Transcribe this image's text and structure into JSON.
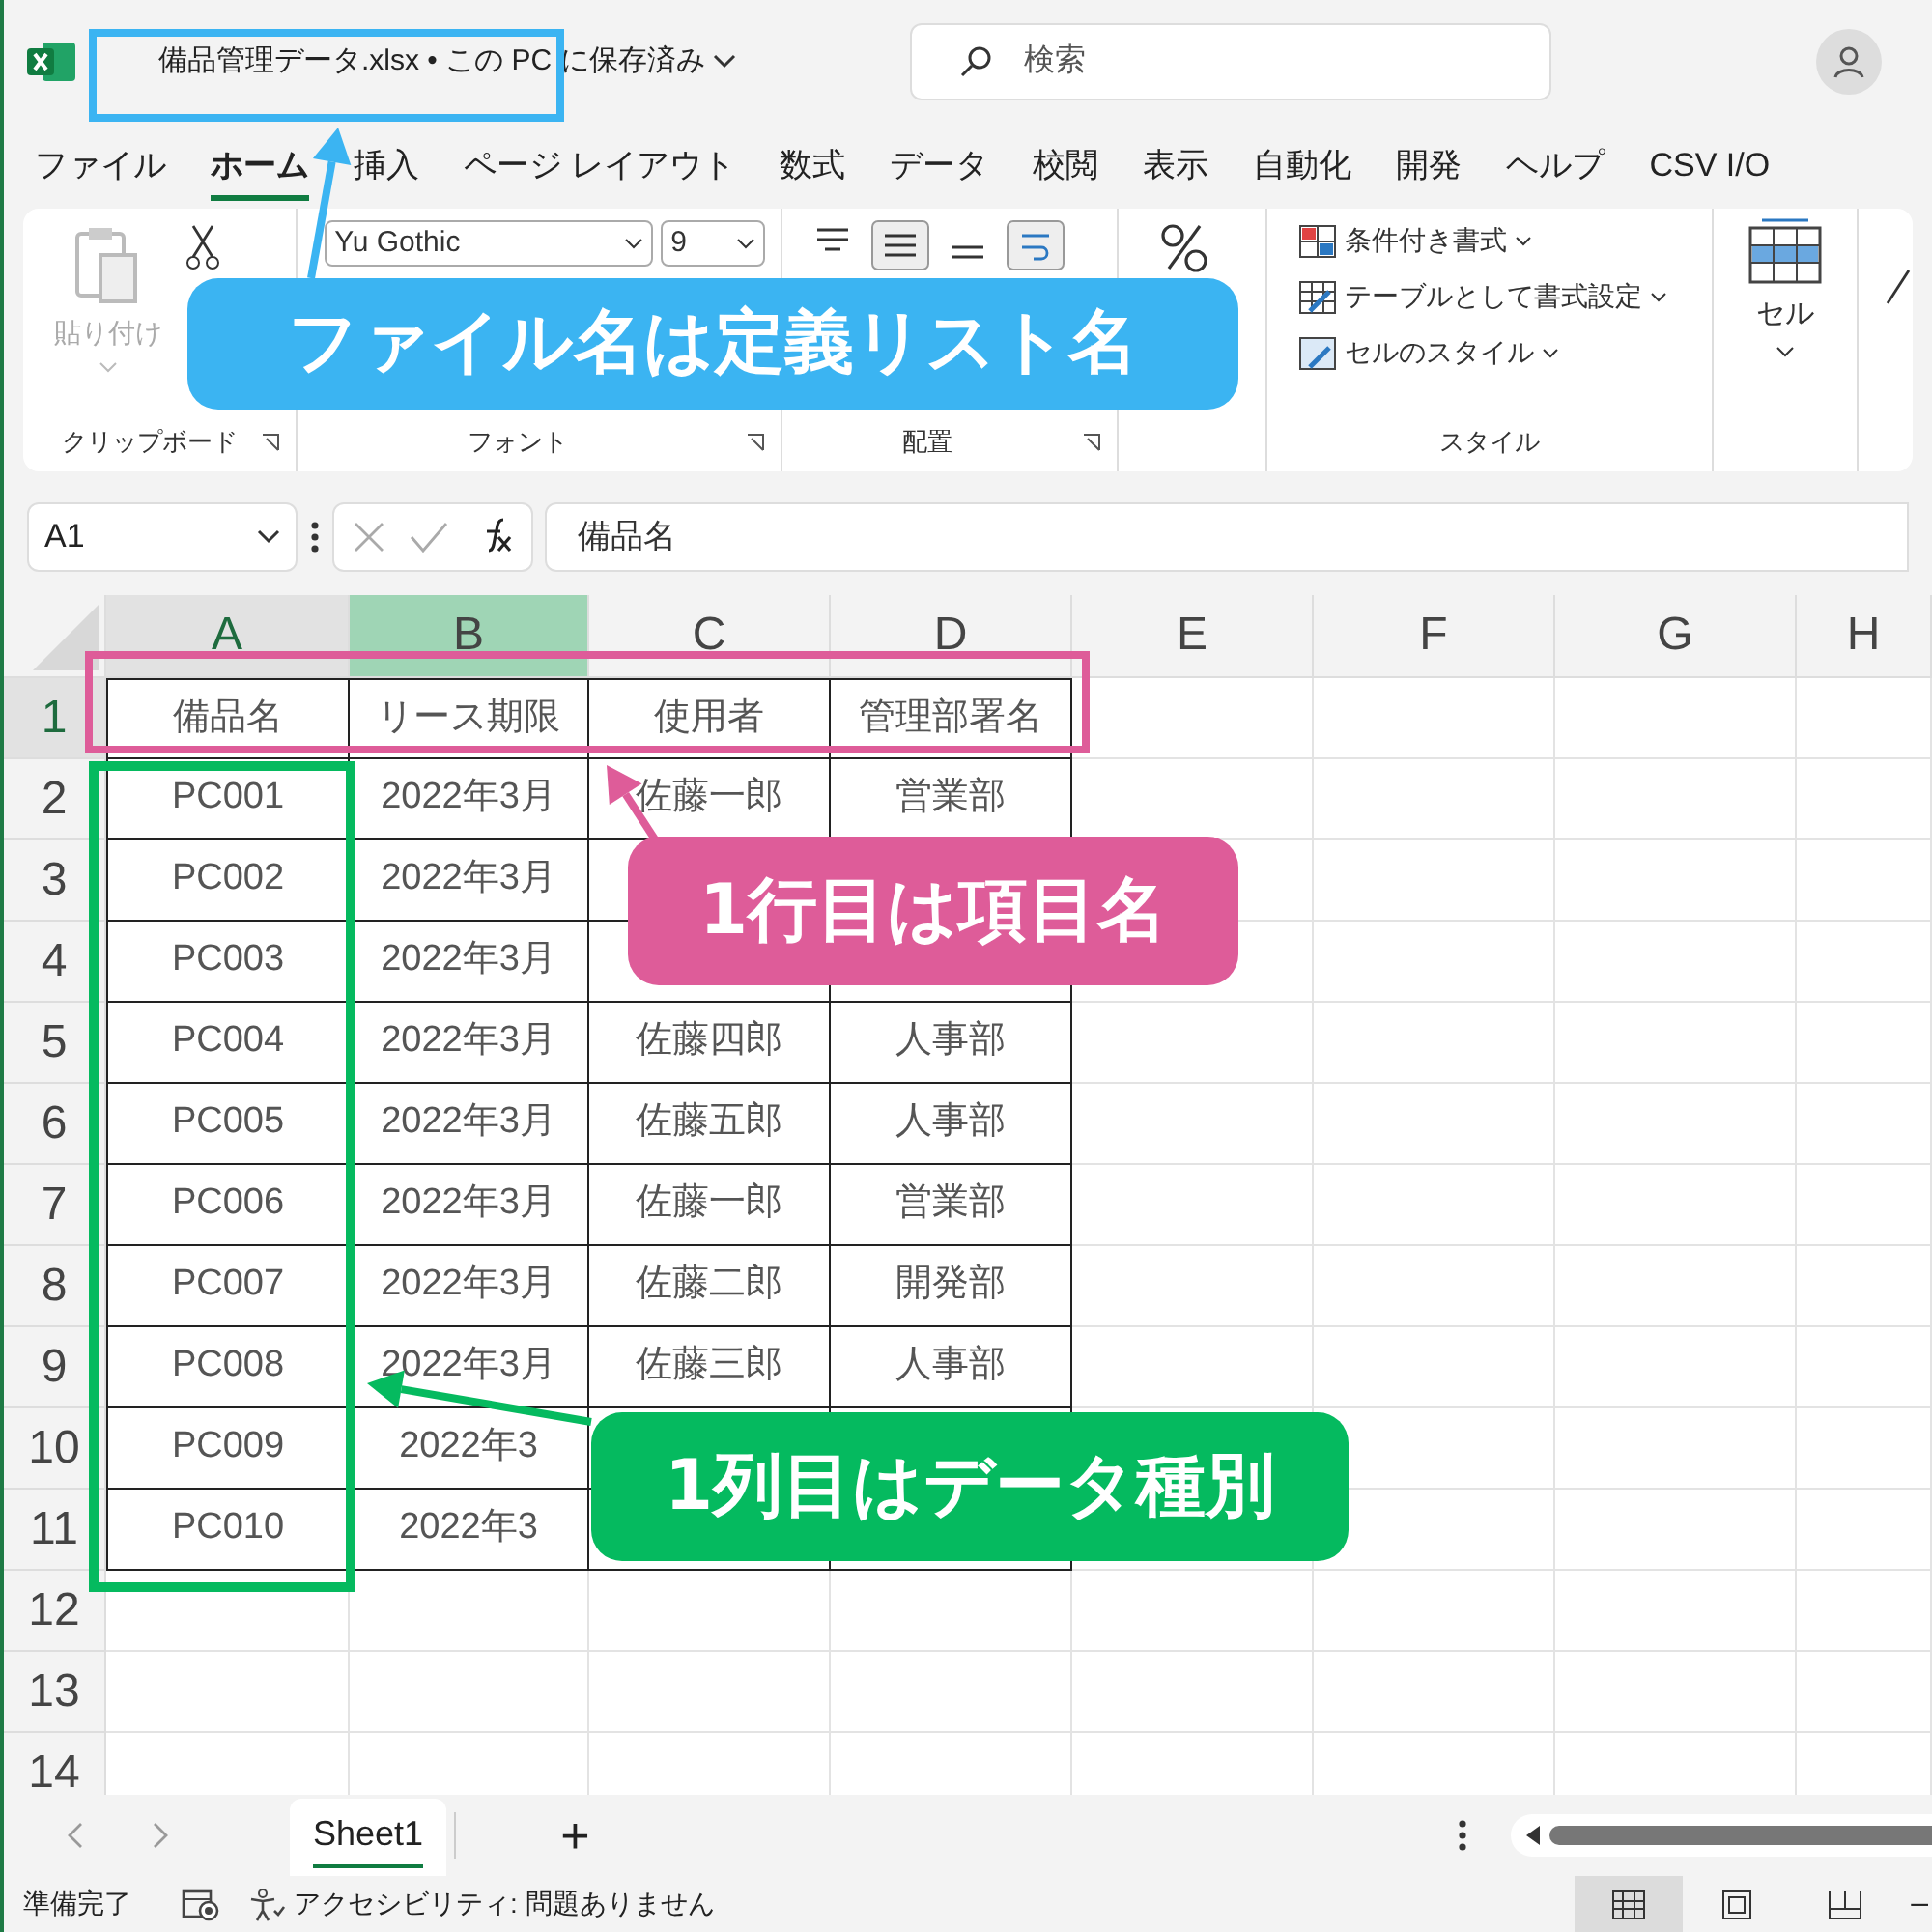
{
  "title_bar": {
    "file_title": "備品管理データ.xlsx • この PC に保存済み",
    "search": {
      "placeholder": "検索"
    }
  },
  "menu_tabs": [
    {
      "label": "ファイル",
      "selected": false
    },
    {
      "label": "ホーム",
      "selected": true
    },
    {
      "label": "挿入",
      "selected": false
    },
    {
      "label": "ページ レイアウト",
      "selected": false
    },
    {
      "label": "数式",
      "selected": false
    },
    {
      "label": "データ",
      "selected": false
    },
    {
      "label": "校閲",
      "selected": false
    },
    {
      "label": "表示",
      "selected": false
    },
    {
      "label": "自動化",
      "selected": false
    },
    {
      "label": "開発",
      "selected": false
    },
    {
      "label": "ヘルプ",
      "selected": false
    },
    {
      "label": "CSV I/O",
      "selected": false
    }
  ],
  "ribbon": {
    "clipboard": {
      "paste": "貼り付け",
      "paste_disabled": true,
      "label": "クリップボード"
    },
    "font": {
      "name": "Yu Gothic",
      "size": "9",
      "label": "フォント"
    },
    "alignment": {
      "label": "配置"
    },
    "styles": {
      "items": [
        "条件付き書式",
        "テーブルとして書式設定",
        "セルのスタイル"
      ],
      "label": "スタイル"
    },
    "cells": {
      "label": "セル"
    }
  },
  "formula_bar": {
    "name_box": "A1",
    "formula": "備品名"
  },
  "columns": [
    {
      "label": "A",
      "active": true,
      "selected": false,
      "in_table": true
    },
    {
      "label": "B",
      "active": false,
      "selected": true,
      "in_table": true
    },
    {
      "label": "C",
      "active": false,
      "selected": false,
      "in_table": true
    },
    {
      "label": "D",
      "active": false,
      "selected": false,
      "in_table": true
    },
    {
      "label": "E",
      "active": false,
      "selected": false,
      "in_table": false
    },
    {
      "label": "F",
      "active": false,
      "selected": false,
      "in_table": false
    },
    {
      "label": "G",
      "active": false,
      "selected": false,
      "in_table": false
    },
    {
      "label": "H",
      "active": false,
      "selected": false,
      "in_table": false
    }
  ],
  "rows": [
    {
      "number": "1",
      "active": true,
      "bordered": true,
      "cells": {
        "A": "備品名",
        "B": "リース期限",
        "C": "使用者",
        "D": "管理部署名"
      }
    },
    {
      "number": "2",
      "active": false,
      "bordered": true,
      "cells": {
        "A": "PC001",
        "B": "2022年3月",
        "C": "佐藤一郎",
        "D": "営業部"
      }
    },
    {
      "number": "3",
      "active": false,
      "bordered": true,
      "cells": {
        "A": "PC002",
        "B": "2022年3月"
      }
    },
    {
      "number": "4",
      "active": false,
      "bordered": true,
      "cells": {
        "A": "PC003",
        "B": "2022年3月"
      }
    },
    {
      "number": "5",
      "active": false,
      "bordered": true,
      "cells": {
        "A": "PC004",
        "B": "2022年3月",
        "C": "佐藤四郎",
        "D": "人事部"
      }
    },
    {
      "number": "6",
      "active": false,
      "bordered": true,
      "cells": {
        "A": "PC005",
        "B": "2022年3月",
        "C": "佐藤五郎",
        "D": "人事部"
      }
    },
    {
      "number": "7",
      "active": false,
      "bordered": true,
      "cells": {
        "A": "PC006",
        "B": "2022年3月",
        "C": "佐藤一郎",
        "D": "営業部"
      }
    },
    {
      "number": "8",
      "active": false,
      "bordered": true,
      "cells": {
        "A": "PC007",
        "B": "2022年3月",
        "C": "佐藤二郎",
        "D": "開発部"
      }
    },
    {
      "number": "9",
      "active": false,
      "bordered": true,
      "cells": {
        "A": "PC008",
        "B": "2022年3月",
        "C": "佐藤三郎",
        "D": "人事部"
      }
    },
    {
      "number": "10",
      "active": false,
      "bordered": true,
      "cells": {
        "A": "PC009",
        "B": "2022年3"
      }
    },
    {
      "number": "11",
      "active": false,
      "bordered": true,
      "cells": {
        "A": "PC010",
        "B": "2022年3"
      }
    },
    {
      "number": "12",
      "active": false,
      "bordered": false,
      "cells": {}
    },
    {
      "number": "13",
      "active": false,
      "bordered": false,
      "cells": {}
    },
    {
      "number": "14",
      "active": false,
      "bordered": false,
      "cells": {}
    }
  ],
  "sheet_tabs": [
    {
      "label": "Sheet1",
      "selected": true
    }
  ],
  "add_sheet": "+",
  "status_bar": {
    "ready": "準備完了",
    "accessibility": "アクセシビリティ: 問題ありません",
    "views": [
      {
        "selected": true
      },
      {
        "selected": false
      },
      {
        "selected": false
      }
    ],
    "zoom_out": "–"
  },
  "annotations": [
    {
      "text": "ファイル名は定義リスト名",
      "color": "#3bb4f2"
    },
    {
      "text": "1行目は項目名",
      "color": "#de5c99"
    },
    {
      "text": "1列目はデータ種別",
      "color": "#05ba5f"
    }
  ]
}
